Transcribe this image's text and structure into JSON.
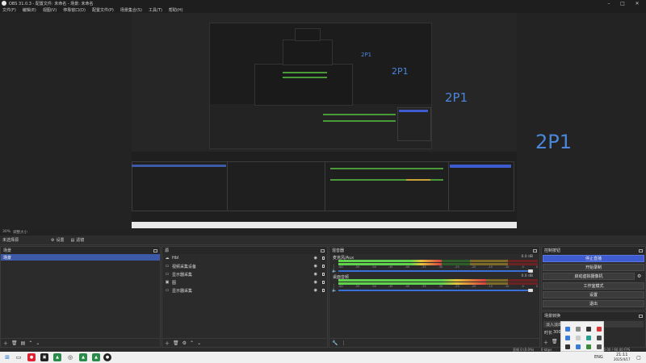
{
  "window": {
    "title": "OBS 31.0.3 - 配置文件: 未命名 - 场景: 未命名"
  },
  "menu": [
    "文件(F)",
    "编辑(E)",
    "视图(V)",
    "停靠窗口(D)",
    "配置文件(P)",
    "场景集合(S)",
    "工具(T)",
    "帮助(H)"
  ],
  "preview": {
    "labels": [
      "2P1",
      "2P1",
      "2P1"
    ],
    "zoom": "30%",
    "zoom_label": "调整大小"
  },
  "props_bar": {
    "label": "未选择源",
    "settings": "设置",
    "filters": "滤镜"
  },
  "scenes": {
    "title": "场景",
    "items": [
      "场景"
    ],
    "selected": 0
  },
  "sources": {
    "title": "源",
    "items": [
      {
        "name": "Hbl",
        "icon": "cloud-icon"
      },
      {
        "name": "视频采集设备",
        "icon": "camera-icon"
      },
      {
        "name": "显示器采集",
        "icon": "monitor-icon"
      },
      {
        "name": "图",
        "icon": "image-icon"
      },
      {
        "name": "显示器采集",
        "icon": "display-capture-icon"
      }
    ]
  },
  "mixer": {
    "title": "混音器",
    "channels": [
      {
        "name": "麦克风/Aux",
        "db": "0.0 dB",
        "level": 0.52,
        "volume": 1.0
      },
      {
        "name": "桌面音频",
        "db": "0.0 dB",
        "level": 0.74,
        "volume": 1.0
      }
    ],
    "ticks": [
      "-60",
      "-55",
      "-50",
      "-45",
      "-40",
      "-35",
      "-30",
      "-25",
      "-20",
      "-15",
      "-10",
      "-5",
      "0"
    ]
  },
  "controls": {
    "title": "控制按钮",
    "buttons": [
      "停止直播",
      "开始录制",
      "启动虚拟摄像机",
      "工作室模式",
      "设置",
      "退出"
    ],
    "active": 0
  },
  "transitions": {
    "title": "场景转换",
    "type": "淡入淡出",
    "duration_label": "时长",
    "duration": "300 ms"
  },
  "status": {
    "dropped": "丢帧 0 (0.0%)",
    "bitrate": "0 kbps",
    "live": "00:00:00",
    "rec": "00:00:00",
    "cpu": "CPU: 1.1%",
    "fps": "60.00 / 60.00 FPS"
  },
  "taskbar": {
    "lang": "ENG",
    "time": "21:11",
    "date": "2025/4/17"
  },
  "colors": {
    "accent": "#3e5bd0",
    "preview_text": "#4a86d9",
    "meter_green": "#5fd34c",
    "meter_yellow": "#e6c43a",
    "meter_red": "#d84040"
  }
}
